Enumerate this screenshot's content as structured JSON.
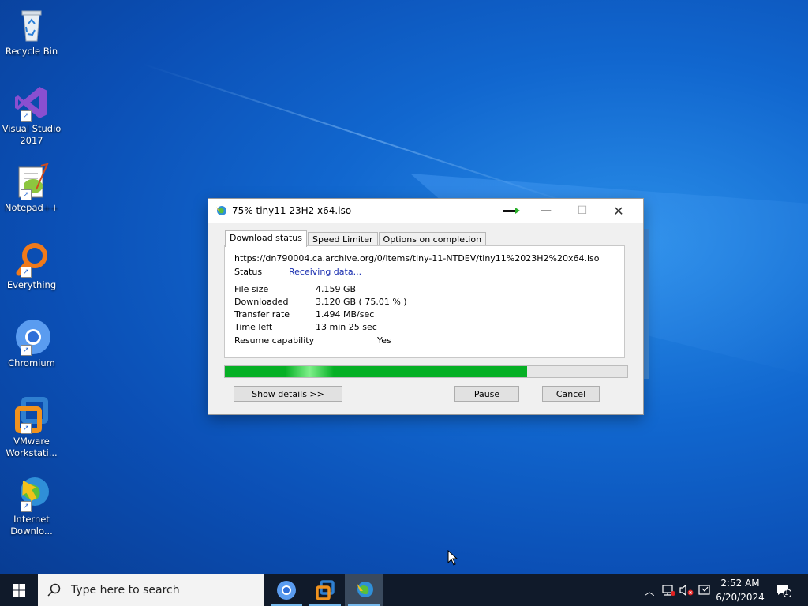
{
  "desktop": {
    "icons": [
      {
        "label": "Recycle Bin"
      },
      {
        "label": "Visual Studio 2017"
      },
      {
        "label": "Notepad++"
      },
      {
        "label": "Everything"
      },
      {
        "label": "Chromium"
      },
      {
        "label": "VMware Workstati..."
      },
      {
        "label": "Internet Downlo..."
      }
    ]
  },
  "dialog": {
    "title": "75% tiny11 23H2 x64.iso",
    "tabs": [
      "Download status",
      "Speed Limiter",
      "Options on completion"
    ],
    "url": "https://dn790004.ca.archive.org/0/items/tiny-11-NTDEV/tiny11%2023H2%20x64.iso",
    "status_label": "Status",
    "status_value": "Receiving data...",
    "file_size_label": "File size",
    "file_size_value": "4.159  GB",
    "downloaded_label": "Downloaded",
    "downloaded_value": "3.120  GB  ( 75.01 % )",
    "transfer_rate_label": "Transfer rate",
    "transfer_rate_value": "1.494  MB/sec",
    "time_left_label": "Time left",
    "time_left_value": "13 min 25 sec",
    "resume_label": "Resume capability",
    "resume_value": "Yes",
    "progress_percent": 75.01,
    "buttons": {
      "show_details": "Show details >>",
      "pause": "Pause",
      "cancel": "Cancel"
    },
    "colors": {
      "progress": "#06b025",
      "status_text": "#1a2fb0"
    }
  },
  "taskbar": {
    "search_placeholder": "Type here to search",
    "time": "2:52 AM",
    "date": "6/20/2024",
    "notification_count": "1"
  }
}
